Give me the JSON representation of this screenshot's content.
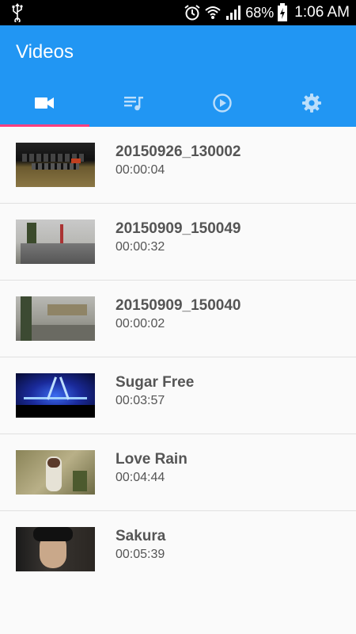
{
  "status": {
    "battery": "68%",
    "time": "1:06 AM"
  },
  "app": {
    "title": "Videos"
  },
  "tabs": [
    {
      "icon": "video-camera-icon"
    },
    {
      "icon": "playlist-icon"
    },
    {
      "icon": "play-circle-icon"
    },
    {
      "icon": "gear-icon"
    }
  ],
  "videos": [
    {
      "name": "20150926_130002",
      "duration": "00:00:04"
    },
    {
      "name": "20150909_150049",
      "duration": "00:00:32"
    },
    {
      "name": "20150909_150040",
      "duration": "00:00:02"
    },
    {
      "name": "Sugar Free",
      "duration": "00:03:57"
    },
    {
      "name": "Love Rain",
      "duration": "00:04:44"
    },
    {
      "name": "Sakura",
      "duration": "00:05:39"
    }
  ]
}
